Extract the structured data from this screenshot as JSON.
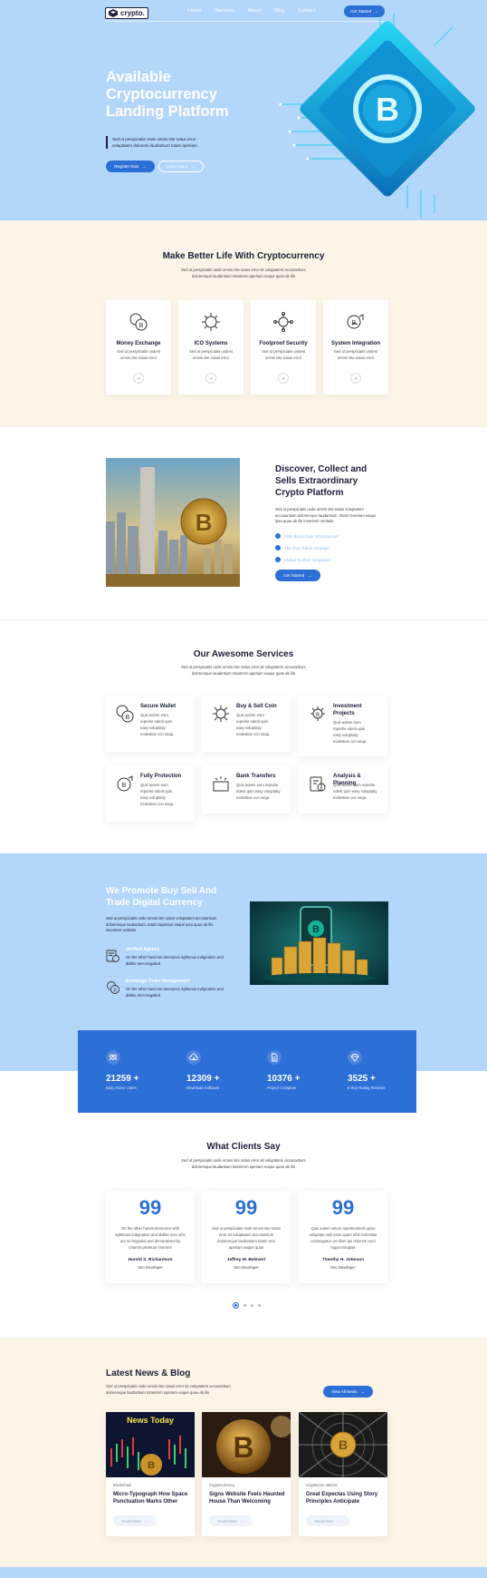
{
  "nav": {
    "brand": "crypto.",
    "links": [
      "Home",
      "Services",
      "About",
      "Blog",
      "Contact"
    ],
    "cta": "Get Started"
  },
  "hero": {
    "title": "Available Cryptocurrency Landing Platform",
    "description": "Sed ut perspiciatis unde omnis iste natus error voluptatem doloremi laudantium totam aperiam.",
    "primary_btn": "Register Now",
    "secondary_btn": "Learn More"
  },
  "features": {
    "title": "Make Better Life With Cryptocurrency",
    "subtitle": "Sed ut perspiciatis unde omnis iste natus error sit voluptatem accusantium doloremque laudantium totamrem aperiam eaque quae ab illo",
    "cards": [
      {
        "title": "Money Exchange",
        "desc": "Sed ut perspiciatis undest omnis iste natus error",
        "icon": "coins-icon"
      },
      {
        "title": "ICO Systems",
        "desc": "Sed ut perspiciatis undest omnis iste natus error",
        "icon": "circuit-icon"
      },
      {
        "title": "Foolproof Security",
        "desc": "Sed ut perspiciatis undest omnis iste natus error",
        "icon": "security-icon"
      },
      {
        "title": "System Integration",
        "desc": "Sed ut perspiciatis undest omnis iste natus error",
        "icon": "integration-icon"
      }
    ]
  },
  "discover": {
    "title": "Discover, Collect and Sells Extraordinary Crypto Platform",
    "description": "Sed ut perspiciatis unde omnis iste natus voluptatem accusantium doloremque laudantium, totam rexeriam eaque ipsa quae ab illo inventore veritatis.",
    "checks": [
      "Safe Blockchain Infrastructure",
      "The True Game Changer",
      "Global Sustain Integration"
    ],
    "button": "Get Started"
  },
  "services": {
    "title": "Our Awesome Services",
    "subtitle": "Sed ut perspiciatis unde omnis iste natus error sit voluptatem accusantium doloremque laudantium totamrem aperiam eaque quae ab illo",
    "items": [
      {
        "title": "Secure Wallet",
        "desc": "Quis autem eum reprehe nderit quin easy voluptatiy molestiae con seqa.",
        "icon": "wallet-coins-icon"
      },
      {
        "title": "Buy & Sell Coin",
        "desc": "Quis autem eum reprehe nderit quin easy voluptatiy molestiae con seqa.",
        "icon": "circuit-icon"
      },
      {
        "title": "Investment Projects",
        "desc": "Quis autem eum reprehe nderit quin easy voluptatiy molestiae con seqa.",
        "icon": "investment-icon"
      },
      {
        "title": "Fully Protection",
        "desc": "Quis autem eum reprehe nderit quin easy voluptatiy molestiae con seqa.",
        "icon": "protection-icon"
      },
      {
        "title": "Bank Transfers",
        "desc": "Quis autem eum reprehe nderit quin easy voluptatiy molestiae con seqa.",
        "icon": "bank-transfer-icon"
      },
      {
        "title": "Analysis & Planning",
        "desc": "Quis autem eum reprehe nderit quin easy voluptatiy molestiae con seqa.",
        "icon": "analysis-icon"
      }
    ]
  },
  "promote": {
    "title": "We Promote Buy Sell And Trade Digital Currency",
    "description": "Sed ut perspiciatis unde omnis iste natus voluptatem accusantium doloremque laudantium, totam raperiam eaque ipsa quae ab illo inventore veritatis.",
    "items": [
      {
        "title": "Verified Agency",
        "desc": "On the other hand we denounce righteous indignation and dislike men beguiled"
      },
      {
        "title": "Exchange Order Management",
        "desc": "On the other hand we denounce righteous indignation and dislike men beguiled"
      }
    ]
  },
  "stats": [
    {
      "value": "21259 +",
      "label": "Daily Active Users",
      "icon": "users-icon"
    },
    {
      "value": "12309 +",
      "label": "Download Software",
      "icon": "cloud-download-icon"
    },
    {
      "value": "10376 +",
      "label": "Project Complete",
      "icon": "document-icon"
    },
    {
      "value": "3525 +",
      "label": "5 Star Rating Reviews",
      "icon": "diamond-icon"
    }
  ],
  "clients": {
    "title": "What Clients Say",
    "subtitle": "Sed ut perspiciatis unde omnis iste natus error sit voluptatem accusantium doloremque laudantium totamrem aperiam eaque quae ab illo",
    "items": [
      {
        "quote": "On the other hands denounce with righteous indignation and dislike men who are so beguiled and demoralized by charms pleasure moment",
        "name": "Harold S. Richardson",
        "role": "Seo Developer"
      },
      {
        "quote": "Sed ut perspiciatis unde omnis iste natus error sit voluptatem accusantium doloremque laudantium totam rem aperiam eaque quae",
        "name": "Jeffrey M. Belevert",
        "role": "Seo Developer"
      },
      {
        "quote": "Quis autem velum reprehenderit quine voluptate velit esse quam nihil molestiae consequatur vel illum qui dolorem eum fugiat voluptas",
        "name": "Timothy H. Johnson",
        "role": "Seo Developer"
      }
    ]
  },
  "news": {
    "title": "Latest News & Blog",
    "subtitle": "Sed ut perspiciatis unde omnis iste natus error sit voluptatem accusantium doloremque laudantium totamrem aperiam eaque quae ab illo",
    "view_all": "View All News",
    "posts": [
      {
        "category": "Blockchain",
        "title": "Micro-Typograph How Space Punctuation Marks Other",
        "read_more": "Read More",
        "image_text": "News Today"
      },
      {
        "category": "Cryptocurrency",
        "title": "Signs Website Feels Haunted House Than Welcoming",
        "read_more": "Read More"
      },
      {
        "category": "Cryptocoin, Bitcoin",
        "title": "Great Expectas Using Story Principles Anticipate",
        "read_more": "Read More"
      }
    ]
  },
  "colors": {
    "primary": "#2c6fd6",
    "hero_bg": "#b3d6fb",
    "cream": "#fdf4e8",
    "dark": "#1b1f3a"
  }
}
